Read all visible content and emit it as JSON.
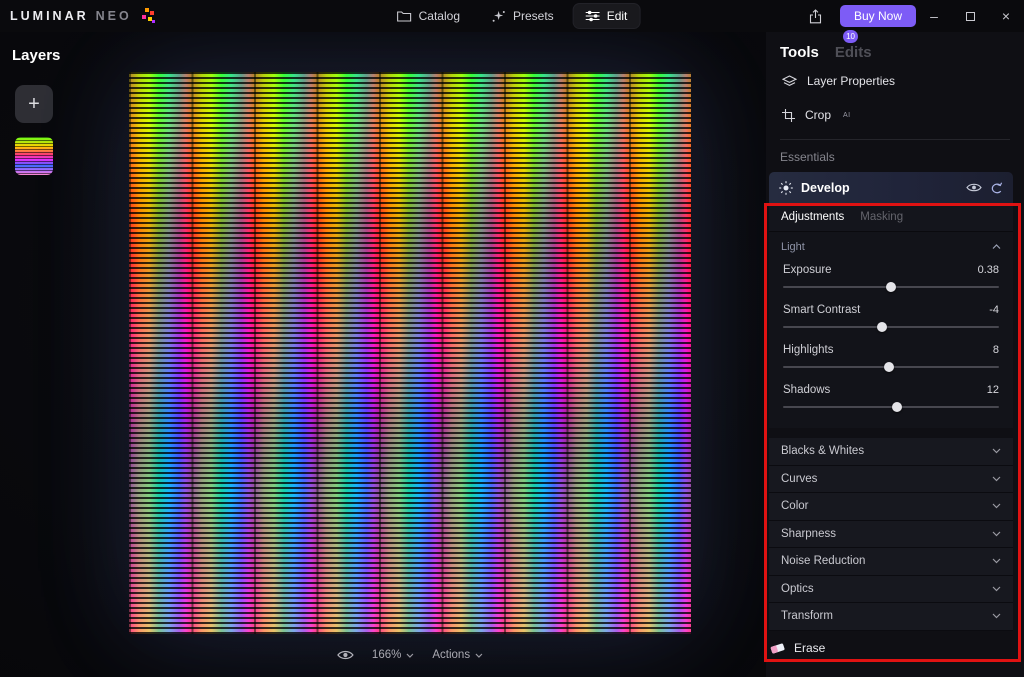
{
  "topbar": {
    "logo_luminar": "LUMINAR",
    "logo_neo": "NEO",
    "catalog": "Catalog",
    "presets": "Presets",
    "edit": "Edit",
    "buy_now": "Buy Now",
    "notification_count": "10",
    "window": {
      "minimize": "–",
      "close": "×"
    }
  },
  "layers_panel": {
    "title": "Layers",
    "add": "+"
  },
  "canvas_toolbar": {
    "zoom": "166%",
    "actions": "Actions"
  },
  "right_panel": {
    "tools_tab": "Tools",
    "edits_tab": "Edits",
    "layer_properties": "Layer Properties",
    "crop": "Crop",
    "crop_badge": "AI",
    "essentials": "Essentials",
    "develop": {
      "title": "Develop",
      "adjustments_tab": "Adjustments",
      "masking_tab": "Masking",
      "light": {
        "title": "Light",
        "sliders": [
          {
            "label": "Exposure",
            "value": "0.38",
            "percent": 50
          },
          {
            "label": "Smart Contrast",
            "value": "-4",
            "percent": 46
          },
          {
            "label": "Highlights",
            "value": "8",
            "percent": 49
          },
          {
            "label": "Shadows",
            "value": "12",
            "percent": 53
          }
        ]
      },
      "collapsed": [
        "Blacks & Whites",
        "Curves",
        "Color",
        "Sharpness",
        "Noise Reduction",
        "Optics",
        "Transform"
      ]
    },
    "erase": "Erase"
  },
  "colors": {
    "accent_purple": "#7d5cf6",
    "annotation_red": "#e01212"
  }
}
